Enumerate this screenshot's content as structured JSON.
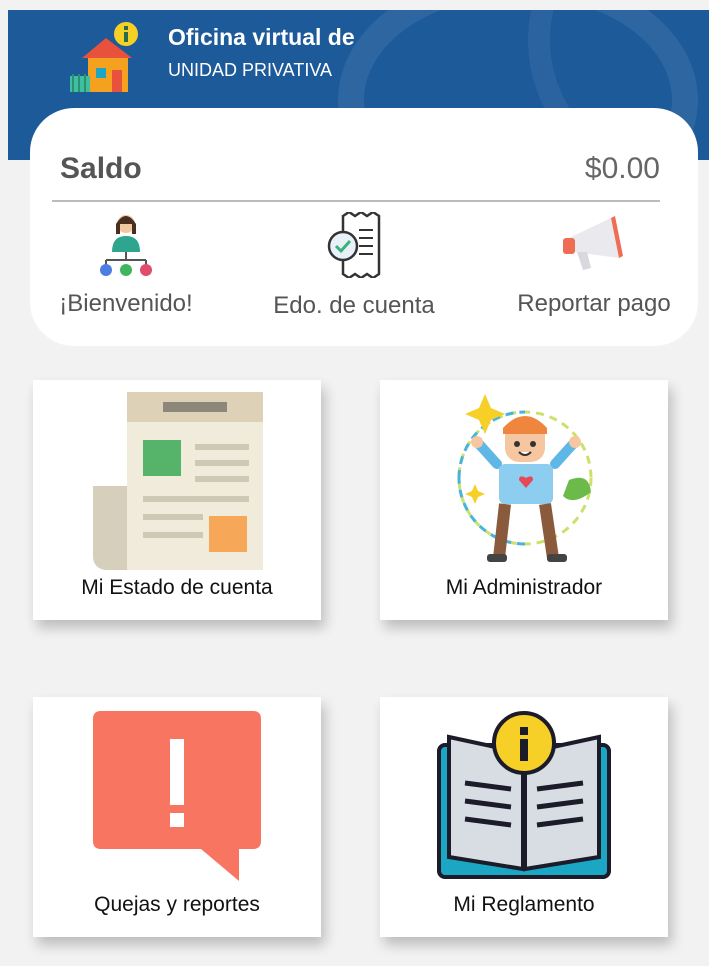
{
  "header": {
    "title": "Oficina virtual de",
    "subtitle": "UNIDAD PRIVATIVA",
    "logo_icon": "house-info-icon",
    "bg_color": "#1d5a99"
  },
  "balance": {
    "label": "Saldo",
    "value": "$0.00"
  },
  "quick_actions": [
    {
      "label": "¡Bienvenido!",
      "icon": "welcome-network-icon"
    },
    {
      "label": "Edo. de cuenta",
      "icon": "receipt-check-icon"
    },
    {
      "label": "Reportar pago",
      "icon": "megaphone-icon"
    }
  ],
  "tiles": [
    {
      "label": "Mi Estado de cuenta",
      "icon": "newspaper-icon"
    },
    {
      "label": "Mi Administrador",
      "icon": "happy-person-icon"
    },
    {
      "label": "Quejas y reportes",
      "icon": "alert-speech-bubble-icon"
    },
    {
      "label": "Mi Reglamento",
      "icon": "info-book-icon"
    }
  ],
  "colors": {
    "background": "#f2f2f2",
    "complaint_red": "#f87561",
    "book_teal": "#1ba6c4",
    "info_yellow": "#f6cf27"
  }
}
